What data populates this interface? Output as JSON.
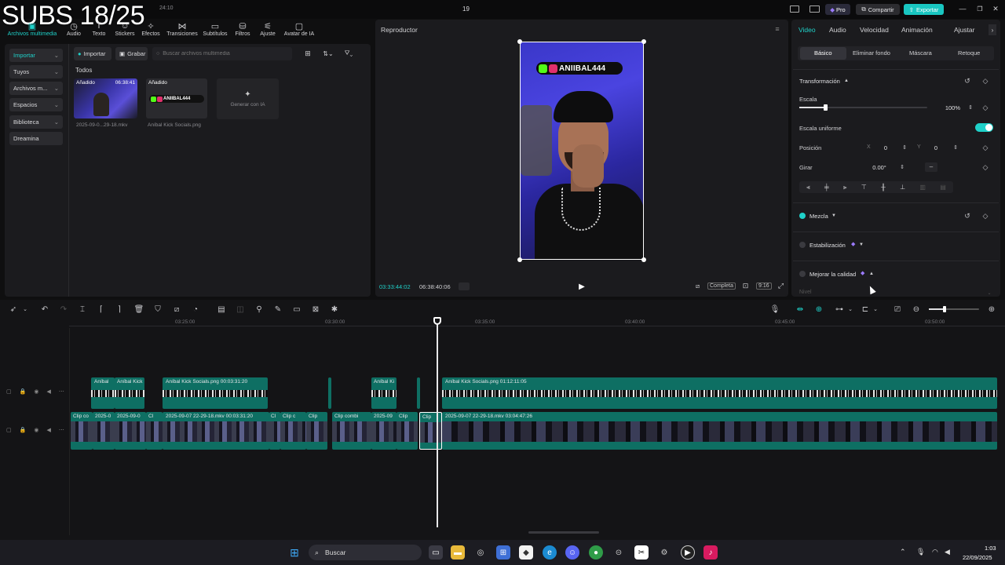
{
  "overlay_text": "SUBS 18/25",
  "titlebar": {
    "center_number": "19",
    "time_fragment": "24:10",
    "pro_label": "Pro",
    "share_label": "Compartir",
    "export_label": "Exportar"
  },
  "topnav": [
    {
      "label": "Archivos multimedia",
      "icon": "media-icon"
    },
    {
      "label": "Audio",
      "icon": "audio-icon"
    },
    {
      "label": "Texto",
      "icon": "text-icon"
    },
    {
      "label": "Stickers",
      "icon": "sticker-icon"
    },
    {
      "label": "Efectos",
      "icon": "effects-icon"
    },
    {
      "label": "Transiciones",
      "icon": "transition-icon"
    },
    {
      "label": "Subtítulos",
      "icon": "subtitle-icon"
    },
    {
      "label": "Filtros",
      "icon": "filter-icon"
    },
    {
      "label": "Ajuste",
      "icon": "adjust-icon"
    },
    {
      "label": "Avatar de IA",
      "icon": "avatar-icon"
    }
  ],
  "sidebar": {
    "items": [
      {
        "label": "Importar"
      },
      {
        "label": "Tuyos"
      },
      {
        "label": "Archivos m..."
      },
      {
        "label": "Espacios"
      },
      {
        "label": "Biblioteca"
      },
      {
        "label": "Dreamina"
      }
    ]
  },
  "media": {
    "import_label": "Importar",
    "record_label": "Grabar",
    "search_placeholder": "Buscar archivos multimedia",
    "section_title": "Todos",
    "items": [
      {
        "badge": "Añadido",
        "duration": "06:38:41",
        "name": "2025-09-0...29-18.mkv"
      },
      {
        "badge": "Añadido",
        "duration": "",
        "name": "Aníbal Kick Socials.png"
      }
    ],
    "generate_label": "Generar con IA"
  },
  "player": {
    "title": "Reproductor",
    "current_time": "03:33:44:02",
    "total_time": "06:38:40:06",
    "full_label": "Completa",
    "ratio_label": "9:16",
    "banner_text": "ANIIBAL444"
  },
  "right_panel": {
    "tabs": [
      "Video",
      "Audio",
      "Velocidad",
      "Animación",
      "Ajustar"
    ],
    "subtabs": [
      "Básico",
      "Eliminar fondo",
      "Máscara",
      "Retoque"
    ],
    "transform_label": "Transformación",
    "scale_label": "Escala",
    "scale_value": "100%",
    "scale_fraction": 0.2,
    "uniform_label": "Escala uniforme",
    "position_label": "Posición",
    "pos_x_label": "X",
    "pos_x": "0",
    "pos_y_label": "Y",
    "pos_y": "0",
    "rotate_label": "Girar",
    "rotate_value": "0.00°",
    "rotate_extra": "–",
    "blend_label": "Mezcla",
    "stabilize_label": "Estabilización",
    "quality_label": "Mejorar la calidad",
    "level_label": "Nivel"
  },
  "timeline": {
    "ruler": [
      "03:25:00",
      "03:30:00",
      "03:35:00",
      "03:40:00",
      "03:45:00",
      "03:50:00"
    ],
    "overlay_clips": [
      {
        "label": "Aníbal"
      },
      {
        "label": "Aníbal Kick"
      },
      {
        "label": "Aníbal Kick Socials.png   00:03:31:20"
      },
      {
        "label": "Aníbal Ki"
      },
      {
        "label": "Aníbal Kick Socials.png   01:12:11:05"
      }
    ],
    "video_clips": [
      {
        "label": "Clip co"
      },
      {
        "label": "2025-0"
      },
      {
        "label": "2025-09-0"
      },
      {
        "label": "Cl"
      },
      {
        "label": "2025-09-07 22-29-18.mkv   00:03:31:20"
      },
      {
        "label": "Cl"
      },
      {
        "label": "Clip c"
      },
      {
        "label": "Clip"
      },
      {
        "label": "Clip combi"
      },
      {
        "label": "2025-09"
      },
      {
        "label": "Clip"
      },
      {
        "label": "Clip"
      },
      {
        "label": "2025-09-07 22-29-18.mkv   03:04:47:26"
      }
    ]
  },
  "taskbar": {
    "search_label": "Buscar",
    "time": "1:03",
    "date": "22/09/2025"
  }
}
